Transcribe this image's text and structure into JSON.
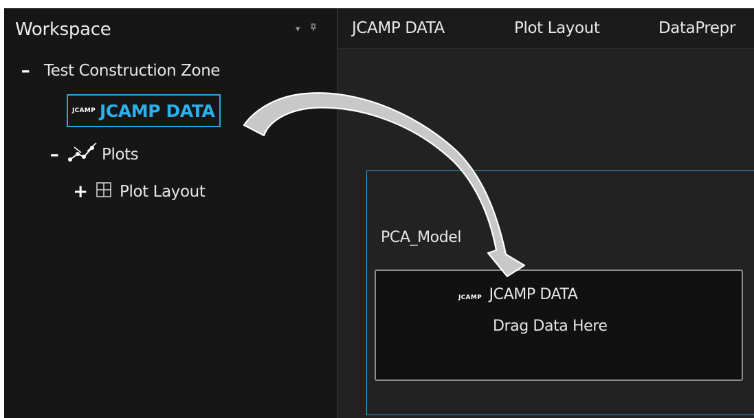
{
  "workspace": {
    "title": "Workspace",
    "pin_glyph": "⊟",
    "dropdown_glyph": "▾",
    "tree": {
      "zone": {
        "toggle": "–",
        "label": "Test Construction Zone"
      },
      "jcamp": {
        "badge": "JCAMP",
        "label": "JCAMP DATA"
      },
      "plots": {
        "toggle": "–",
        "label": "Plots",
        "icon": "scatter-plot-icon"
      },
      "plot_layout": {
        "toggle": "+",
        "label": "Plot Layout",
        "icon": "grid-icon"
      }
    }
  },
  "tabs": [
    {
      "label": "JCAMP DATA"
    },
    {
      "label": "Plot Layout"
    },
    {
      "label": "DataPrepr"
    }
  ],
  "canvas": {
    "model_label": "PCA_Model",
    "drop_zone": {
      "badge": "JCAMP",
      "title": "JCAMP DATA",
      "hint": "Drag Data Here"
    }
  },
  "colors": {
    "accent": "#2aa7e0",
    "panel_bg": "#161616",
    "canvas_bg": "#222222",
    "text": "#e6e6e6"
  }
}
